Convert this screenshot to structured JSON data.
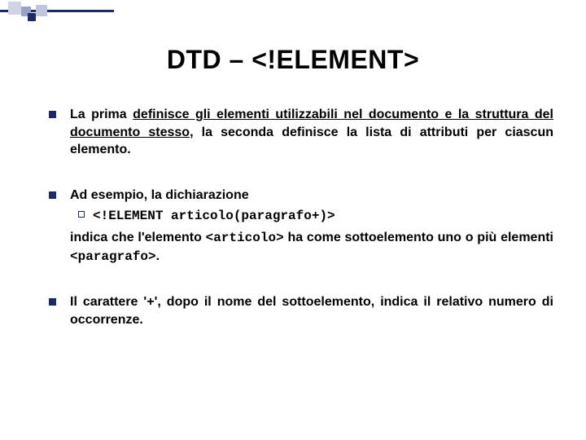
{
  "title": "DTD – <!ELEMENT>",
  "bullets": {
    "b1_pre": "La prima ",
    "b1_u": "definisce gli elementi utilizzabili nel documento e la struttura del documento stesso",
    "b1_post": ", la seconda definisce la lista di attributi per ciascun elemento.",
    "b2_lead": "Ad esempio, la dichiarazione",
    "b2_code": "<!ELEMENT articolo(paragrafo+)>",
    "b2_p1": "indica che l'elemento ",
    "b2_c1": "<articolo>",
    "b2_p2": " ha come sottoelemento uno o più elementi ",
    "b2_c2": "<paragrafo>",
    "b2_p3": ".",
    "b3": "Il carattere '+', dopo il nome del sottoelemento, indica il relativo numero di occorrenze."
  }
}
